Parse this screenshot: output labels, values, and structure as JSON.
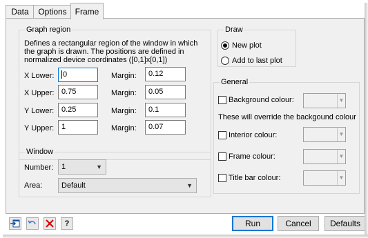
{
  "tabs": [
    "Data",
    "Options",
    "Frame"
  ],
  "graph_region": {
    "title": "Graph region",
    "description": [
      "Defines a rectangular region of the window in which",
      "the graph is drawn. The positions are defined in",
      "normalized device coordinates ([0,1]x[0,1])"
    ],
    "x_lower_label": "X Lower:",
    "x_lower_value": "0",
    "x_upper_label": "X Upper:",
    "x_upper_value": "0.75",
    "y_lower_label": "Y Lower:",
    "y_lower_value": "0.25",
    "y_upper_label": "Y Upper:",
    "y_upper_value": "1",
    "margin_label": "Margin:",
    "margins": [
      "0.12",
      "0.05",
      "0.1",
      "0.07"
    ]
  },
  "window": {
    "title": "Window",
    "number_label": "Number:",
    "number_value": "1",
    "area_label": "Area:",
    "area_value": "Default"
  },
  "draw": {
    "title": "Draw",
    "new_plot": "New plot",
    "add_to_last": "Add to last plot",
    "selected": "new_plot"
  },
  "general": {
    "title": "General",
    "background_colour": "Background colour:",
    "override_note": "These will override the backgound colour",
    "interior_colour": "Interior colour:",
    "frame_colour": "Frame colour:",
    "title_bar_colour": "Title bar colour:"
  },
  "buttons": {
    "run": "Run",
    "cancel": "Cancel",
    "defaults": "Defaults",
    "help_glyph": "?"
  },
  "colors": {
    "accent": "#0078d7",
    "panel": "#f0f0f0",
    "close_red": "#d40000"
  }
}
